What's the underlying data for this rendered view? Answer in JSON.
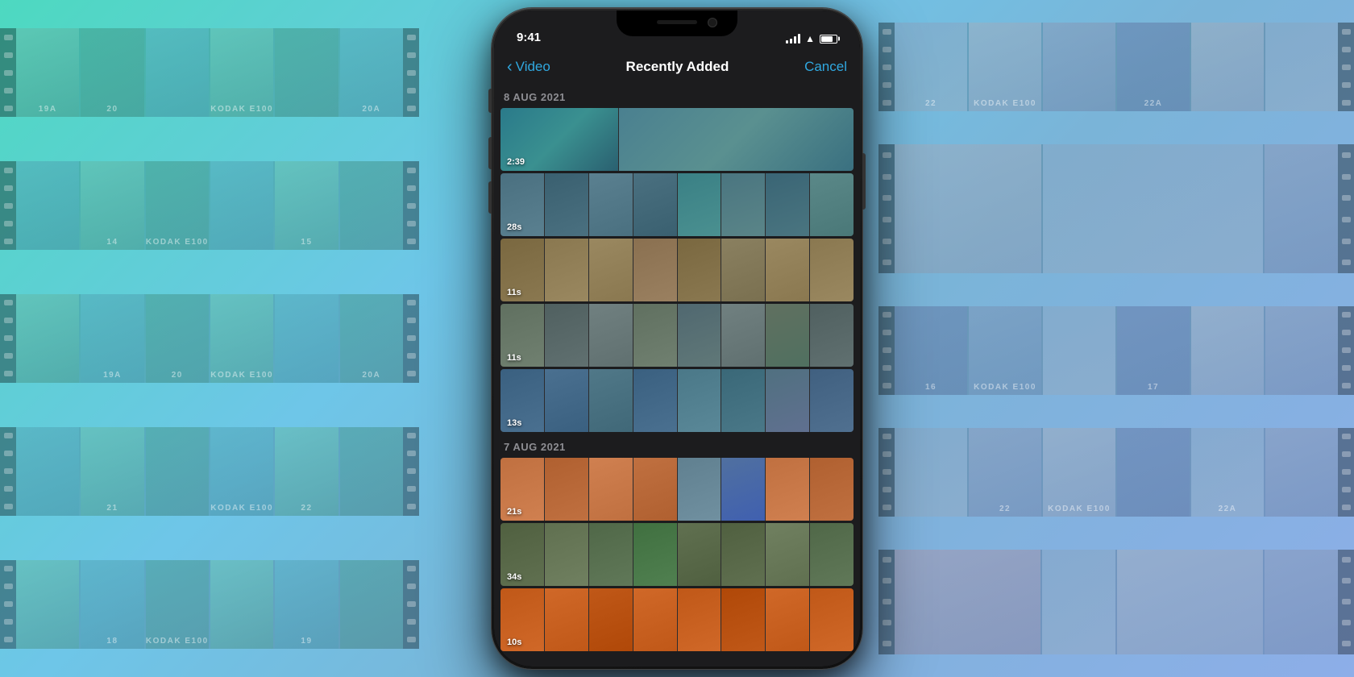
{
  "background": {
    "gradient": "linear-gradient(135deg, #4dd9c0 0%, #6ec6e8 35%, #7ab4d8 60%, #8daee8 100%)"
  },
  "film": {
    "kodak_label": "KODAK E100",
    "frame_numbers_left": [
      "19A",
      "20",
      "20A",
      "14",
      "19A",
      "20",
      "20A"
    ],
    "frame_numbers_right": [
      "22",
      "22A",
      "16",
      "17",
      "22",
      "22A"
    ]
  },
  "phone": {
    "status_bar": {
      "time": "9:41",
      "signal": true,
      "wifi": true,
      "battery": "75%"
    },
    "nav": {
      "back_label": "Video",
      "title": "Recently Added",
      "cancel_label": "Cancel"
    },
    "sections": [
      {
        "date": "8 AUG 2021",
        "videos": [
          {
            "duration": "2:39",
            "frames": [
              "teal",
              "teal",
              "coast",
              "coast"
            ]
          },
          {
            "duration": "28s",
            "frames": [
              "coast",
              "coast",
              "coast",
              "coast",
              "coast",
              "coast",
              "coast"
            ]
          },
          {
            "duration": "11s",
            "frames": [
              "beach",
              "beach",
              "beach",
              "beach",
              "beach",
              "beach",
              "beach"
            ]
          },
          {
            "duration": "11s",
            "frames": [
              "rock",
              "rock",
              "rock",
              "rock",
              "rock",
              "rock",
              "rock"
            ]
          },
          {
            "duration": "13s",
            "frames": [
              "sea",
              "sea",
              "sea",
              "sea",
              "sea",
              "sea",
              "sea"
            ]
          }
        ]
      },
      {
        "date": "7 AUG 2021",
        "videos": [
          {
            "duration": "21s",
            "frames": [
              "sunset",
              "sunset",
              "sunset",
              "sunset",
              "sunset",
              "sunset",
              "sunset"
            ]
          },
          {
            "duration": "34s",
            "frames": [
              "palm",
              "palm",
              "palm",
              "palm",
              "palm",
              "palm",
              "palm"
            ]
          },
          {
            "duration": "10s",
            "frames": [
              "orange",
              "orange",
              "orange",
              "orange",
              "orange",
              "orange",
              "orange"
            ]
          }
        ]
      }
    ]
  }
}
